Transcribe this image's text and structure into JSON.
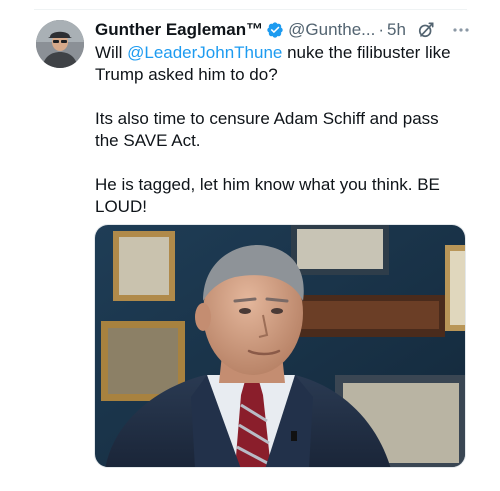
{
  "author": {
    "display_name": "Gunther Eagleman™",
    "handle": "@Gunthe...",
    "separator": "·",
    "time": "5h"
  },
  "body": {
    "line1_prefix": "Will ",
    "line1_mention": "@LeaderJohnThune",
    "line1_suffix": " nuke the filibuster like Trump asked him to do?",
    "paragraph2": "Its also time to censure Adam Schiff and pass the SAVE Act.",
    "paragraph3": "He is tagged,  let him know what you think.  BE LOUD!"
  },
  "icons": {
    "verified": "verified-badge-icon",
    "grok": "grok-icon",
    "more": "more-icon"
  },
  "colors": {
    "text": "#0f1419",
    "secondary": "#536471",
    "link": "#1d9bf0",
    "verified": "#1d9bf0"
  }
}
